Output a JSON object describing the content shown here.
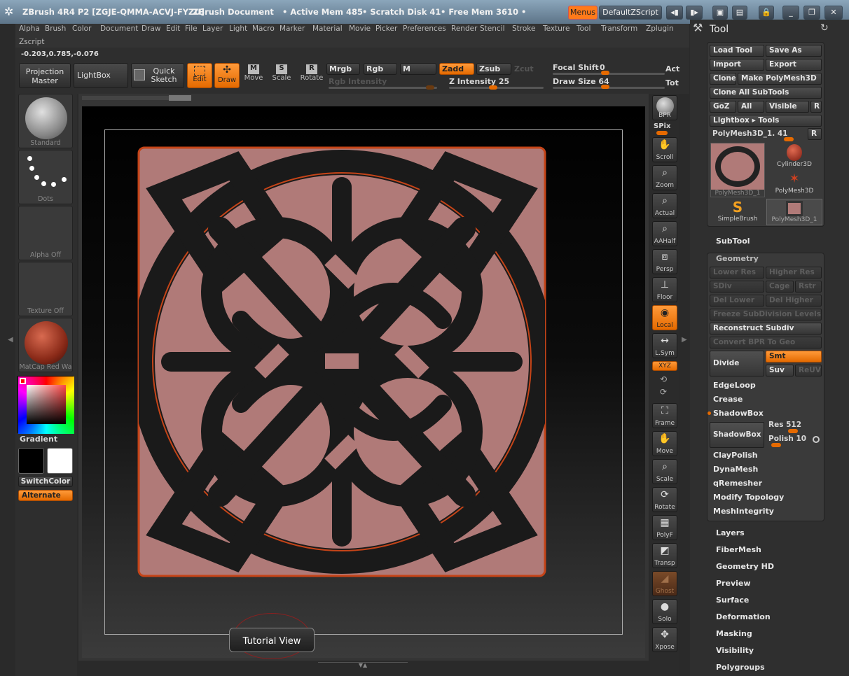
{
  "titlebar": {
    "app": "ZBrush 4R4 P2 [ZGJE-QMMA-ACVJ-FYZU]",
    "doc": "ZBrush Document",
    "active_mem": "• Active Mem 485",
    "scratch": "• Scratch Disk 41",
    "free_mem": "• Free Mem 3610 •",
    "menus_btn": "Menus",
    "script_btn": "DefaultZScript"
  },
  "menubar": {
    "items": [
      "Alpha",
      "Brush",
      "Color",
      "Document",
      "Draw",
      "Edit",
      "File",
      "Layer",
      "Light",
      "Macro",
      "Marker",
      "Material",
      "Movie",
      "Picker",
      "Preferences",
      "Render",
      "Stencil",
      "Stroke",
      "Texture",
      "Tool",
      "Transform",
      "Zplugin"
    ],
    "row2": [
      "Zscript"
    ]
  },
  "coords": "-0.203,0.785,-0.076",
  "shelf": {
    "projection": [
      "Projection",
      "Master"
    ],
    "lightbox": "LightBox",
    "quick_sketch": [
      "Quick",
      "Sketch"
    ],
    "edit": "Edit",
    "draw": "Draw",
    "move": "Move",
    "scale": "Scale",
    "rotate": "Rotate",
    "mrgb": "Mrgb",
    "rgb": "Rgb",
    "m": "M",
    "zadd": "Zadd",
    "zsub": "Zsub",
    "zcut": "Zcut",
    "rgb_intensity": "Rgb Intensity",
    "z_intensity": "Z Intensity 25",
    "z_intensity_value": 25,
    "focal_shift": "Focal Shift",
    "focal_shift_value": "0",
    "draw_size": "Draw Size 64",
    "draw_size_value": 64,
    "act": "Act",
    "tot": "Tot"
  },
  "lefttray": {
    "brush": "Standard",
    "stroke": "Dots",
    "alpha": "Alpha Off",
    "texture": "Texture Off",
    "material": "MatCap Red Wa",
    "gradient": "Gradient",
    "switchcolor": "SwitchColor",
    "alternate": "Alternate",
    "colors": {
      "main": "#000000",
      "secondary": "#ffffff"
    }
  },
  "canvas": {
    "tutorial": "Tutorial View"
  },
  "rshelf": [
    {
      "id": "bpr",
      "label": "BPR",
      "icon": "sphere-icon"
    },
    {
      "id": "spix",
      "label": "SPix",
      "icon": "slider-icon"
    },
    {
      "id": "scroll",
      "label": "Scroll",
      "icon": "scroll-icon"
    },
    {
      "id": "zoom",
      "label": "Zoom",
      "icon": "zoom-icon"
    },
    {
      "id": "actual",
      "label": "Actual",
      "icon": "actual-icon"
    },
    {
      "id": "aahalf",
      "label": "AAHalf",
      "icon": "aahalf-icon"
    },
    {
      "id": "persp",
      "label": "Persp",
      "icon": "persp-icon"
    },
    {
      "id": "floor",
      "label": "Floor",
      "icon": "floor-icon"
    },
    {
      "id": "local",
      "label": "Local",
      "icon": "local-icon"
    },
    {
      "id": "lsym",
      "label": "L.Sym",
      "icon": "lsym-icon"
    },
    {
      "id": "xyz",
      "label": "XYZ",
      "icon": "xyz-icon"
    },
    {
      "id": "frame",
      "label": "Frame",
      "icon": "frame-icon"
    },
    {
      "id": "move",
      "label": "Move",
      "icon": "hand-icon"
    },
    {
      "id": "scale",
      "label": "Scale",
      "icon": "scale-icon"
    },
    {
      "id": "rotate",
      "label": "Rotate",
      "icon": "rotate-icon"
    },
    {
      "id": "polyf",
      "label": "PolyF",
      "icon": "polyf-icon"
    },
    {
      "id": "transp",
      "label": "Transp",
      "icon": "transp-icon"
    },
    {
      "id": "ghost",
      "label": "Ghost",
      "icon": "ghost-icon"
    },
    {
      "id": "solo",
      "label": "Solo",
      "icon": "solo-icon"
    },
    {
      "id": "xpose",
      "label": "Xpose",
      "icon": "xpose-icon"
    }
  ],
  "tool": {
    "title": "Tool",
    "load": "Load Tool",
    "save": "Save As",
    "import": "Import",
    "export": "Export",
    "clone": "Clone",
    "make_poly": "Make PolyMesh3D",
    "clone_all": "Clone All SubTools",
    "goz": "GoZ",
    "all": "All",
    "visible": "Visible",
    "r": "R",
    "lightbox_tools": "Lightbox ▸ Tools",
    "current": "PolyMesh3D_1. 41",
    "thumbs": [
      "PolyMesh3D_1",
      "Cylinder3D",
      "PolyMesh3D",
      "SimpleBrush",
      "PolyMesh3D_1"
    ],
    "subtool": "SubTool",
    "geometry": "Geometry",
    "lower_res": "Lower Res",
    "higher_res": "Higher Res",
    "sdiv": "SDiv",
    "cage": "Cage",
    "rstr": "Rstr",
    "del_lower": "Del Lower",
    "del_higher": "Del Higher",
    "freeze": "Freeze SubDivision Levels",
    "reconstruct": "Reconstruct Subdiv",
    "convert_bpr": "Convert BPR To Geo",
    "divide": "Divide",
    "smt": "Smt",
    "suv": "Suv",
    "reuv": "ReUV",
    "edgeloop": "EdgeLoop",
    "crease": "Crease",
    "shadowbox_head": "ShadowBox",
    "shadowbox_btn": "ShadowBox",
    "res": "Res 512",
    "polish": "Polish 10",
    "claypolish": "ClayPolish",
    "dynamesh": "DynaMesh",
    "qremesher": "qRemesher",
    "modify_topology": "Modify Topology",
    "meshintegrity": "MeshIntegrity",
    "sections": [
      "Layers",
      "FiberMesh",
      "Geometry HD",
      "Preview",
      "Surface",
      "Deformation",
      "Masking",
      "Visibility",
      "Polygroups"
    ]
  }
}
